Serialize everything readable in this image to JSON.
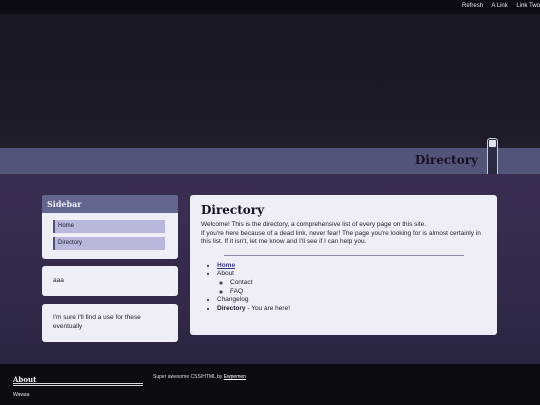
{
  "topnav": {
    "items": [
      "Refresh",
      "A Link",
      "Link Two"
    ]
  },
  "banner": {
    "title": "Directory"
  },
  "sidebar": {
    "title": "Sidebar",
    "links": [
      "Home",
      "Directory"
    ]
  },
  "cards": [
    {
      "text": "aaa"
    },
    {
      "text": "I'm sure I'll find a use for these eventually"
    }
  ],
  "main": {
    "heading": "Directory",
    "intro1": "Welcome! This is the directory, a comprehensive list of every page on this site.",
    "intro2": "If you're here because of a dead link, never fear! The page you're looking for is almost certainly in this list. If it isn't, let me know and I'll see if I can help you.",
    "list": {
      "home": "Home",
      "about": "About",
      "contact": "Contact",
      "faq": "FAQ",
      "changelog": "Changelog",
      "directory": "Directory",
      "directory_suffix": " - You are here!"
    }
  },
  "footer": {
    "about_title": "About",
    "about_text": "Wawaa",
    "credit_prefix": "Super awesome CSS/HTML by ",
    "credit_link": "Ewpemen"
  }
}
